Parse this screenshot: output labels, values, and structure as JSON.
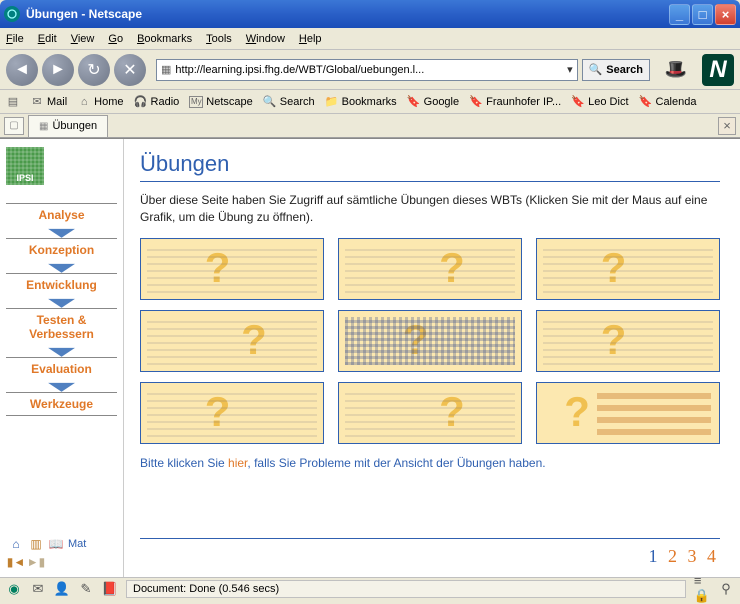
{
  "window": {
    "title": "Übungen - Netscape"
  },
  "menu": {
    "file": "File",
    "edit": "Edit",
    "view": "View",
    "go": "Go",
    "bookmarks": "Bookmarks",
    "tools": "Tools",
    "window": "Window",
    "help": "Help"
  },
  "addressbar": {
    "url": "http://learning.ipsi.fhg.de/WBT/Global/uebungen.l..."
  },
  "search": {
    "label": "Search"
  },
  "bookmarks": {
    "mail": "Mail",
    "home": "Home",
    "radio": "Radio",
    "netscape": "Netscape",
    "search": "Search",
    "bkmk": "Bookmarks",
    "google": "Google",
    "fraunhofer": "Fraunhofer IP...",
    "leo": "Leo Dict",
    "calendar": "Calenda"
  },
  "tab": {
    "label": "Übungen"
  },
  "sidebar": {
    "logo": "IPSI",
    "items": [
      "Analyse",
      "Konzeption",
      "Entwicklung",
      "Testen & Verbessern",
      "Evaluation",
      "Werkzeuge"
    ],
    "mat": "Mat"
  },
  "page": {
    "heading": "Übungen",
    "intro": "Über diese Seite haben Sie Zugriff auf sämtliche Übungen dieses WBTs (Klicken Sie mit der Maus auf eine Grafik, um die Übung zu öffnen).",
    "help_pre": "Bitte klicken Sie ",
    "help_link": "hier",
    "help_post": ", falls Sie Probleme mit der Ansicht der Übungen haben."
  },
  "pager": {
    "current": "1",
    "p2": "2",
    "p3": "3",
    "p4": "4"
  },
  "status": {
    "msg": "Document: Done (0.546 secs)"
  }
}
